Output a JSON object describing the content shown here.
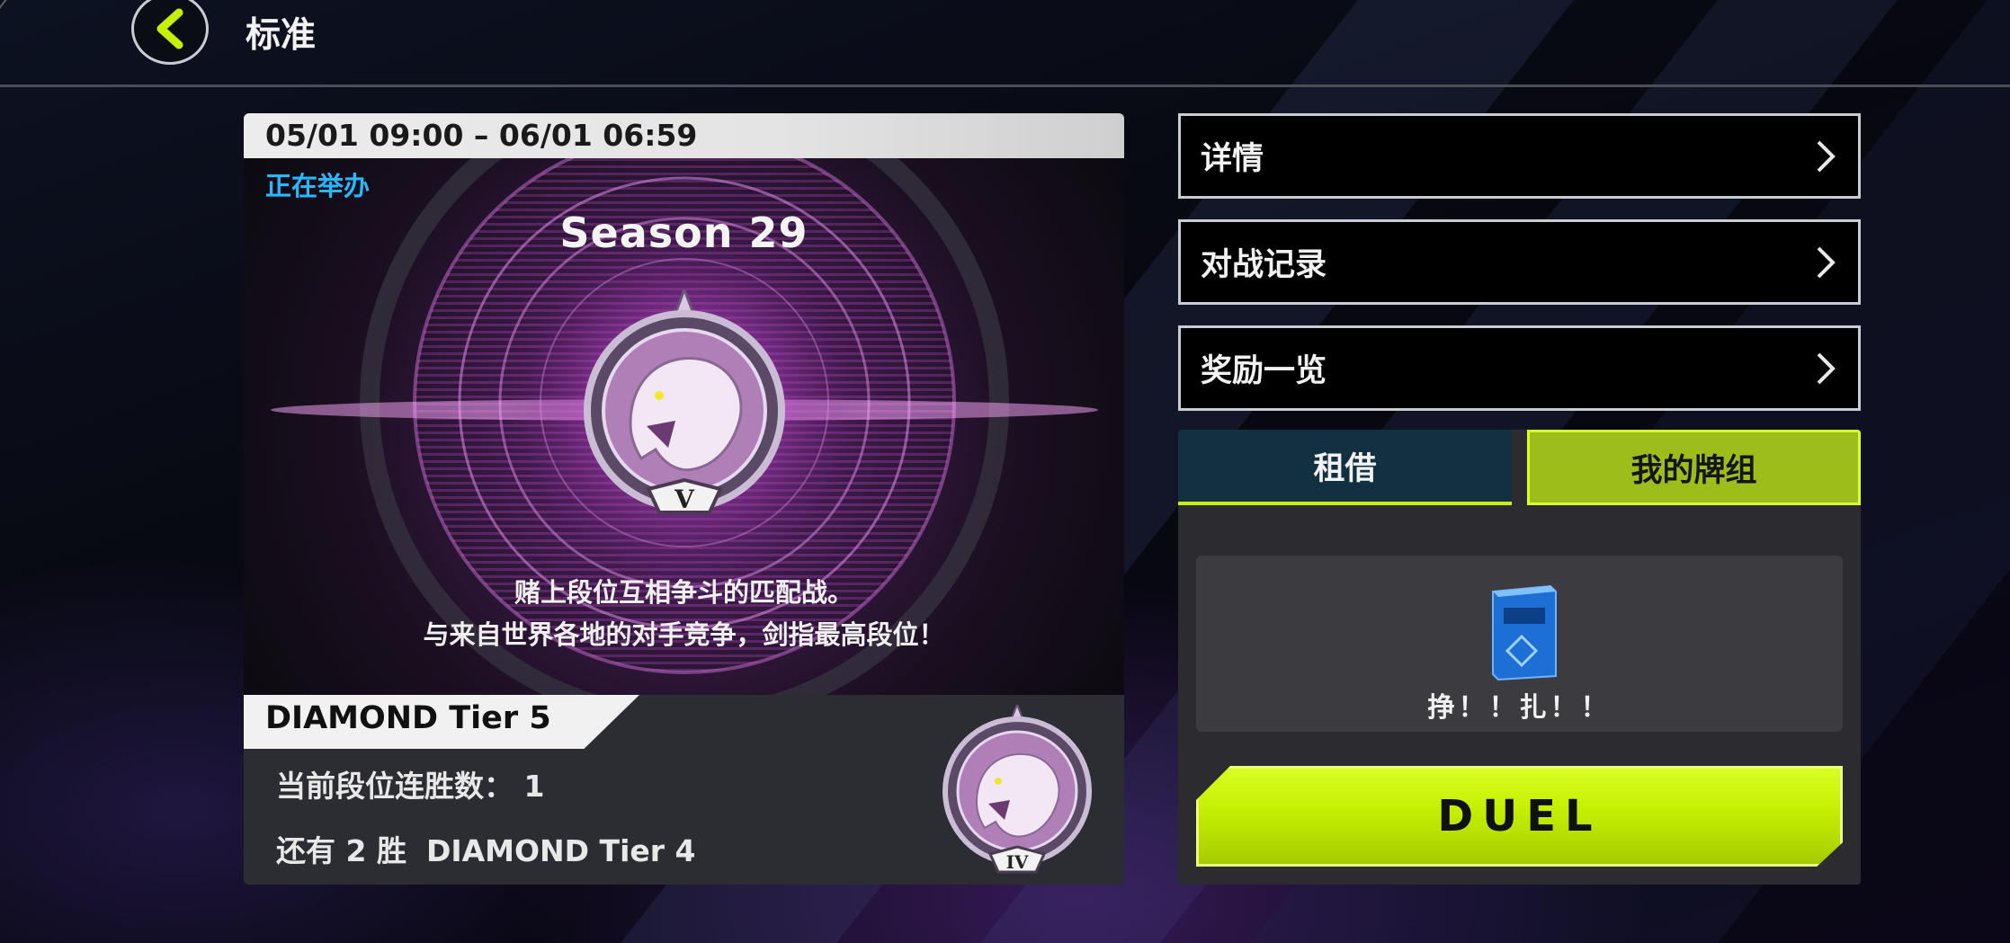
{
  "header": {
    "title": "标准",
    "back_icon": "chevron-left-icon"
  },
  "event": {
    "date_range": "05/01 09:00 – 06/01 06:59",
    "status": "正在举办",
    "season_title": "Season 29",
    "emblem_numeral": "V",
    "description_line1": "赌上段位互相争斗的匹配战。",
    "description_line2": "与来自世界各地的对手竞争，剑指最高段位！"
  },
  "rank": {
    "current_tier": "DIAMOND Tier 5",
    "streak_label": "当前段位连胜数：",
    "streak_value": "1",
    "next_prefix": "还有 2 胜",
    "next_tier": "DIAMOND Tier 4",
    "next_emblem_numeral": "IV"
  },
  "menu": [
    {
      "label": "详情"
    },
    {
      "label": "对战记录"
    },
    {
      "label": "奖励一览"
    }
  ],
  "tabs": {
    "rent": "租借",
    "my_deck": "我的牌组",
    "active": "my_deck"
  },
  "deck": {
    "name": "挣！！扎！！"
  },
  "duel_button": "DUEL",
  "colors": {
    "accent": "#c6f000",
    "live_status": "#28b8ff",
    "rent_tab": "#123041"
  }
}
